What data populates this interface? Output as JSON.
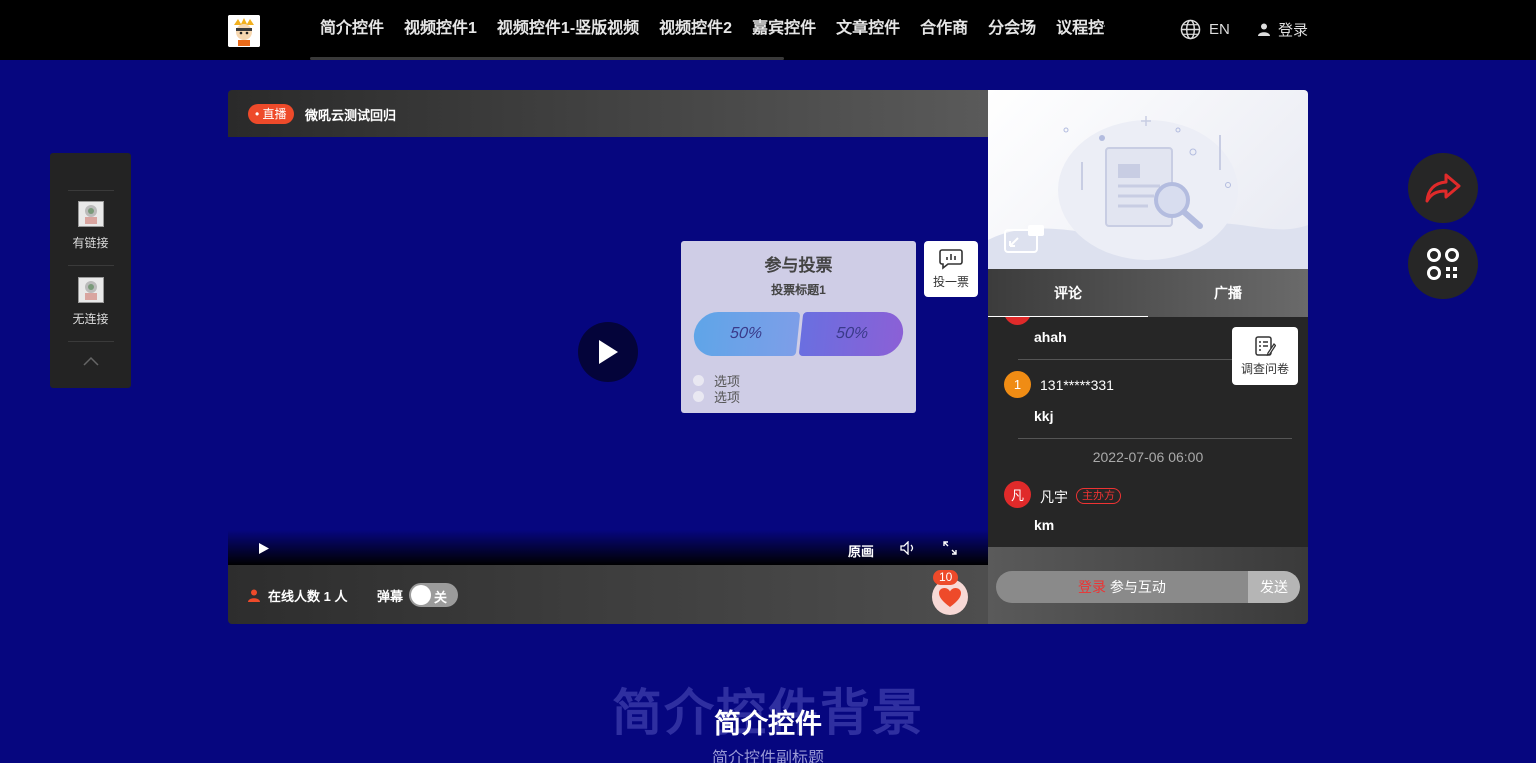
{
  "nav": {
    "items": [
      "简介控件",
      "视频控件1",
      "视频控件1-竖版视频",
      "视频控件2",
      "嘉宾控件",
      "文章控件",
      "合作商",
      "分会场",
      "议程控件"
    ],
    "lang": "EN",
    "login": "登录"
  },
  "left_panel": {
    "items": [
      {
        "label": "有链接"
      },
      {
        "label": "无连接"
      }
    ]
  },
  "player": {
    "live_badge": "• 直播",
    "title": "微吼云测试回归",
    "quality": "原画",
    "online_text": "在线人数 1 人",
    "danmu_label": "弹幕",
    "danmu_state": "关",
    "like_count": "10"
  },
  "vote": {
    "title": "参与投票",
    "subtitle": "投票标题1",
    "bar_a": "50%",
    "bar_b": "50%",
    "options": [
      "选项",
      "选项"
    ],
    "button_label": "投一票"
  },
  "side": {
    "tabs": [
      "评论",
      "广播"
    ],
    "messages": [
      {
        "text": "ahah"
      },
      {
        "avatar": "1",
        "name": "131*****331",
        "text": "kkj",
        "color": "#f08c14"
      },
      {
        "avatar": "凡",
        "name": "凡宇",
        "tag": "主办方",
        "text": "km",
        "color": "#e02a2a"
      }
    ],
    "timestamp": "2022-07-06 06:00",
    "survey_label": "调查问卷",
    "input_login": "登录",
    "input_rest": " 参与互动",
    "send": "发送"
  },
  "section": {
    "bg_title": "简介控件背景",
    "title": "简介控件",
    "subtitle": "简介控件副标题"
  }
}
